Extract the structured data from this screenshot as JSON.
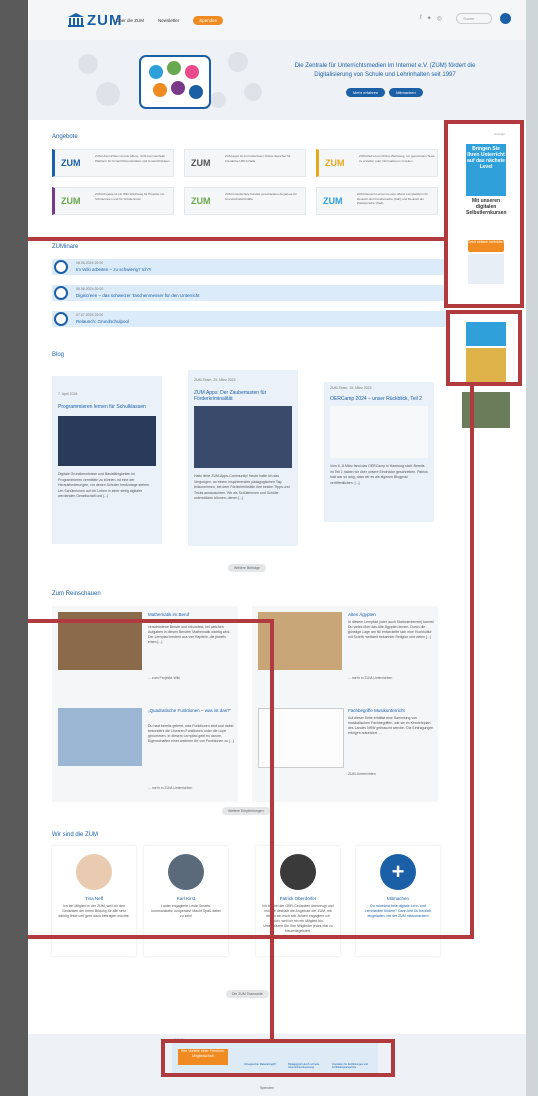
{
  "header": {
    "logo": "ZUM",
    "nav": [
      "Über die ZUM",
      "Newsletter"
    ],
    "donate": "Spenden",
    "search_placeholder": "Suche"
  },
  "hero": {
    "title": "Die Zentrale für Unterrichtsmedien im Internet e.V. (ZUM) fördert die Digitalisierung von Schule und Lehrinhalten seit 1997",
    "btn1": "Mehr erfahren",
    "btn2": "Mitmachen"
  },
  "angebote": {
    "title": "Angebote",
    "cards": [
      {
        "logo": "ZUM",
        "text": "ZUM-Unterrichten ist eine offene, nicht-kommerzielle Plattform für Unterrichtsmaterialien und Unterrichtsideen.",
        "color": "#1b5fa7"
      },
      {
        "logo": "ZUM",
        "text": "ZUM-apps ist ein kostenloser Online-Speicher für interaktive H5P-Inhalte",
        "color": "#555555"
      },
      {
        "logo": "ZUM",
        "text": "ZUM-Pad ist ein Online-Werkzeug, um gemeinsam Texte zu erstellen oder Informationen zu teilen.",
        "color": "#e8a81a"
      },
      {
        "logo": "ZUM",
        "text": "ZUM-Projekte ist ein Wiki-Werkzeug für Projekte mit Schülerinnen und für Schülerinnen",
        "color": "#7a3a8a"
      },
      {
        "logo": "ZUM",
        "text": "ZUM-Grundschule bündelt verschiedene Angebote für Grundschullehrkräfte",
        "color": "#6aa84f"
      },
      {
        "logo": "ZUM",
        "text": "ZUM-Deutsch Lernen ist eine offene Lernplattform für Deutsch als Fremdsprache (DaF) und Deutsch als Zweitsprache (DaZ).",
        "color": "#2fa0da"
      }
    ]
  },
  "side_ad": {
    "label": "Anzeige",
    "blue_text": "Bringen Sie Ihren Unterricht auf das nächste Level",
    "dark_text": "Mit unseren digitalen Selbstlernkursen",
    "button": "Jetzt einfach fortbilden"
  },
  "webinare": {
    "title": "ZUMinare",
    "items": [
      {
        "date": "06.06.2024 20:00",
        "title": "Im Wiki arbeiten – zu schwierig? Ich?!"
      },
      {
        "date": "06.06.2024 20:00",
        "title": "Digiscreen – das schweizer Taschenmesser für den Unterricht"
      },
      {
        "date": "07.07.2024 20:00",
        "title": "Relaunch: Grundschulpool"
      }
    ]
  },
  "blog": {
    "title": "Blog",
    "posts": [
      {
        "meta": "7. April 2024",
        "title": "Programmieren lernen für Schulklassen",
        "text": "Digitale Grundkenntnisse und Basisfähigkeiten im Programmieren vermitteln zu können, ist eine der Herausforderungen, vor denen Schulen heutzutage stehen. Um Schülerinnen auf ein Leben in einer stetig digitaler werdenden Gesellschaft und [...]"
      },
      {
        "meta": "ZUM-Team, 25. März 2024",
        "title": "ZUM Apps: Der Zaubertasten für Förderkriminalität",
        "text": "Hallo liebe ZUM-Apps-Community! Heute hatte ich das Vergnügen, an einem inspirierenden pädagogischen Tag teilzunehmen, bei dem Förderlehrkräfte ihre besten Tipps und Tricks austauschten. Wir als Schülerinnen und Schüler unterstützen können, denen [...]"
      },
      {
        "meta": "ZUM-Team, 15. März 2024",
        "title": "OERCamp 2024 – unser Rückblick, Teil 2",
        "text": "Vom 6.-8.März fand das OERCamp in Hamburg statt. Bereits im Teil 1 haben wir über unsere Eindrücke geschrieben. Patrick hatt war so lang, dass wir es als eigenen Blogpost veröffentlichen. [...]"
      }
    ],
    "more": "Weitere Beiträge"
  },
  "reinschauen": {
    "title": "Zum Reinschauen",
    "items": [
      {
        "title": "Mathematik im Beruf",
        "text": "In diesem Lernpfad bekommst Du einen Einblick in verschiedene Berufe und erkundest, bei welchen Aufgaben in diesen Berufen Mathematik wichtig wird. Der Lernpfad besteht aus vier Kapiteln, die jeweils einen [...]",
        "link": "... zum Projekte-Wiki"
      },
      {
        "title": "Altes Ägypten",
        "text": "In diesem Lernpfad (oder auch Stationenlernen) kannst Du vieles über das Alte Ägypten lernen. Durch die günstige Lage am Nil entwickelte sich eine Hochkultur mit Schrift, weltweit bekannter Religion und vielen [...]",
        "link": "... mehr in ZUM-Unterrichten"
      },
      {
        "title": "„Quadratische Funktionen – was ist das?“",
        "text": "Du hast bereits gelernt, was Funktionen sind und dabei besonders die Linearen Funktionen unter die Lupe genommen. In diesem Lernpfad geht es darum, Eigenschaften einer weiteren Art von Funktionen zu [...]",
        "link": "... mehr in ZUM-Unterrichten"
      },
      {
        "title": "Fachbegriffe Musikunterricht",
        "text": "Auf dieser Seite erhältst eine Sammlung von musikalischen Fachbegriffen, wie sie im Kernlehrplan des Landes NRW gebraucht werden. Die Eintragungen erfolgen autorisiert. ...",
        "link": "ZUM-Unterrichten"
      }
    ],
    "more": "Weitere Empfehlungen"
  },
  "team": {
    "title": "Wir sind die ZUM",
    "members": [
      {
        "name": "Tina Neff",
        "text": "Ich bin Mitglied in der ZUM, weil ich den Gedanken der freien Bildung für alle sehr wichtig finde und gern dazu beitragen möchte."
      },
      {
        "name": "Karl Kirst",
        "text": "Lauter engagierte Leute Smarts, kommunikativ, kooperativ! Macht Spaß dabei zu sein!"
      },
      {
        "name": "Patrick Oberdörfer",
        "text": "Ich bin bei der OER-Gedanken überzeugt und möchte deshalb die Angebote der ZUM, mit denen ich mich seit Jahren engagiere ich mich, weil ich bin ein Mitglied bin. Unterstützen Sie Ihre Mitglieder jedes Mal zu Neuerbegeistert."
      },
      {
        "name": "Mitmachen",
        "text": "Du möchtest freie digitale Lehr- und Lernmedien fördern? Dann bist Du herzlich eingeladen, bei der ZUM mitzumachen!"
      }
    ],
    "more": "Die ZUM Teamseite"
  },
  "footer": {
    "ad_label": "Anzeige",
    "ad_button": "Ihre Vorteile einer Premium-Mitgliedschaft",
    "ad_items": [
      "Unbegrenzter Materialzugriff",
      "Pädagogisch durch schnelle Unterrichtsvorbereitung",
      "Inspiration für Fortbildungen und Fortbildungsangebote"
    ],
    "link": "Spenden"
  }
}
